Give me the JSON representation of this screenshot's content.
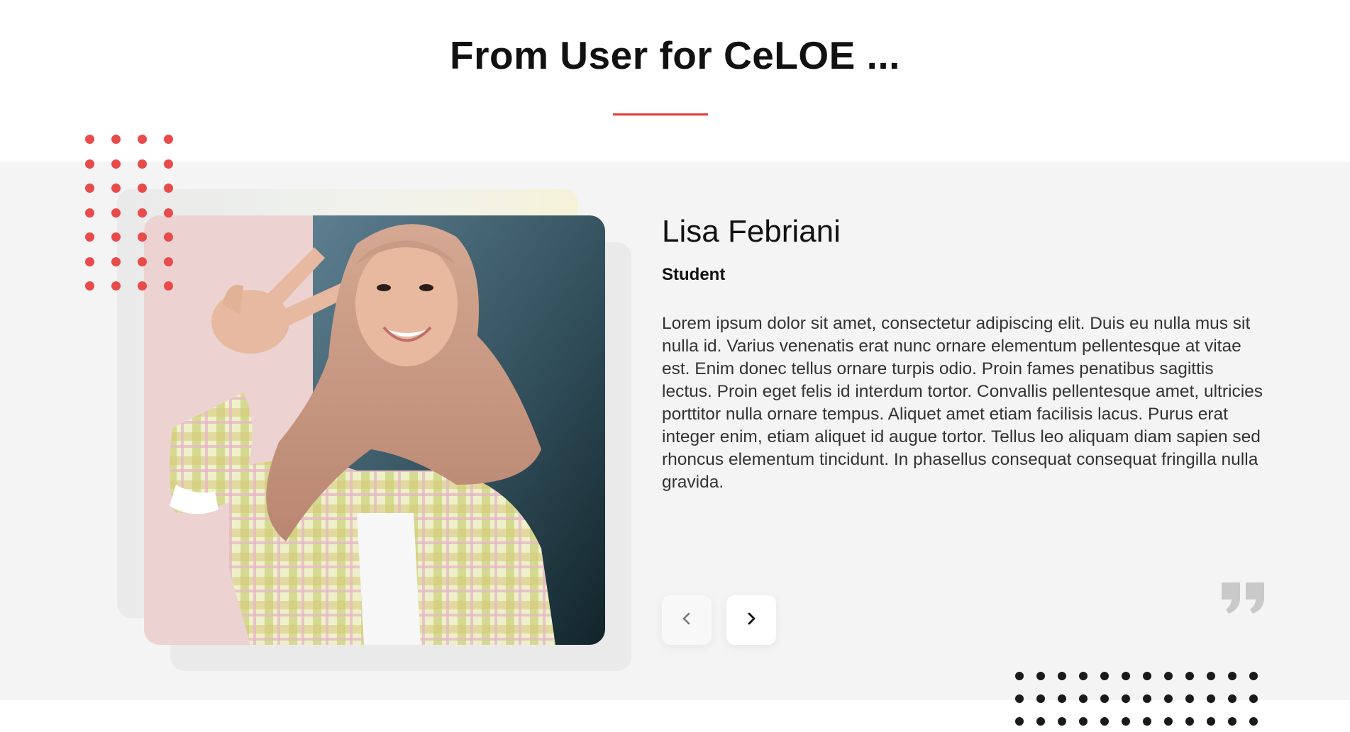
{
  "section": {
    "title": "From User for CeLOE ..."
  },
  "testimonial": {
    "name": "Lisa Febriani",
    "role": "Student",
    "text": "Lorem ipsum dolor sit amet, consectetur adipiscing elit. Duis eu nulla mus sit nulla id. Varius venenatis erat nunc ornare elementum pellentesque at vitae est. Enim donec tellus ornare turpis odio. Proin fames penatibus sagittis lectus. Proin eget felis id interdum tortor. Convallis pellentesque amet, ultricies porttitor nulla ornare tempus. Aliquet amet etiam facilisis lacus. Purus erat integer enim, etiam aliquet id augue tortor. Tellus leo aliquam diam sapien sed rhoncus elementum tincidunt. In phasellus consequat consequat fringilla nulla gravida."
  },
  "controls": {
    "prev_icon": "chevron-left-icon",
    "next_icon": "chevron-right-icon"
  },
  "colors": {
    "accent": "#e03a3a",
    "dot_red": "#e94a4a",
    "dot_black": "#1a1a1a",
    "band": "#f4f4f4",
    "quote_mark": "#c9c9c9"
  }
}
